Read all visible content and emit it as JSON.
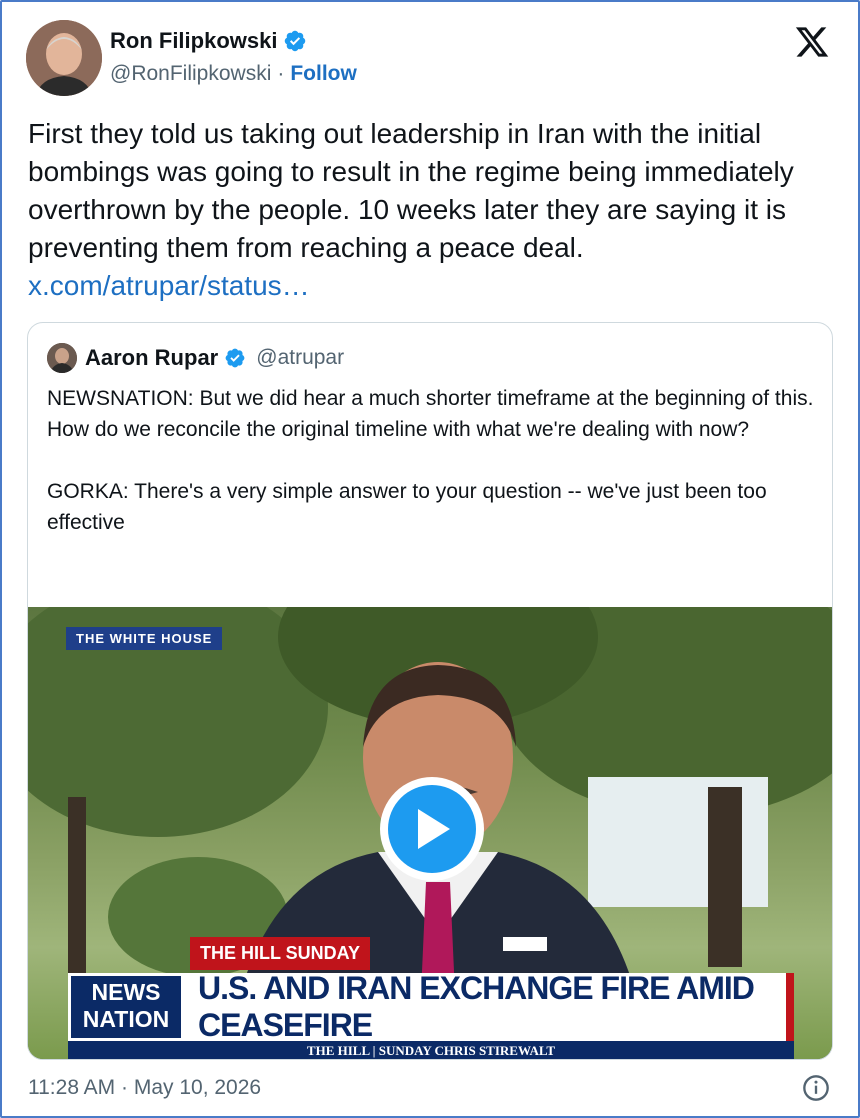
{
  "author": {
    "name": "Ron Filipkowski",
    "handle": "@RonFilipkowski",
    "separator": "·",
    "follow_label": "Follow"
  },
  "tweet": {
    "text": "First they told us taking out leadership in Iran with the initial bombings was going to result in the regime being immediately overthrown by the people. 10 weeks later they are saying it is preventing them from reaching a peace deal. ",
    "link_text": "x.com/atrupar/status…"
  },
  "quoted": {
    "name": "Aaron Rupar",
    "handle": "@atrupar",
    "text": "NEWSNATION: But we did hear a much shorter timeframe at the beginning of this. How do we reconcile the original timeline with what we're dealing with now?\n\nGORKA: There's a very simple answer to your question -- we've just been too effective",
    "video": {
      "location_tag": "THE WHITE HOUSE",
      "show_tag": "THE HILL SUNDAY",
      "network_line1": "NEWS",
      "network_line2": "NATION",
      "headline": "U.S. AND IRAN EXCHANGE FIRE AMID CEASEFIRE",
      "subbar": "THE HILL | SUNDAY CHRIS STIREWALT"
    }
  },
  "footer": {
    "timestamp": "11:28 AM · May 10, 2026"
  },
  "icons": {
    "verified": "verified-badge-icon",
    "x_logo": "x-logo-icon",
    "play": "play-icon",
    "info": "info-icon"
  },
  "colors": {
    "link": "#1d6fc2",
    "verified": "#1d9bf0",
    "border": "#4a7bc8"
  }
}
